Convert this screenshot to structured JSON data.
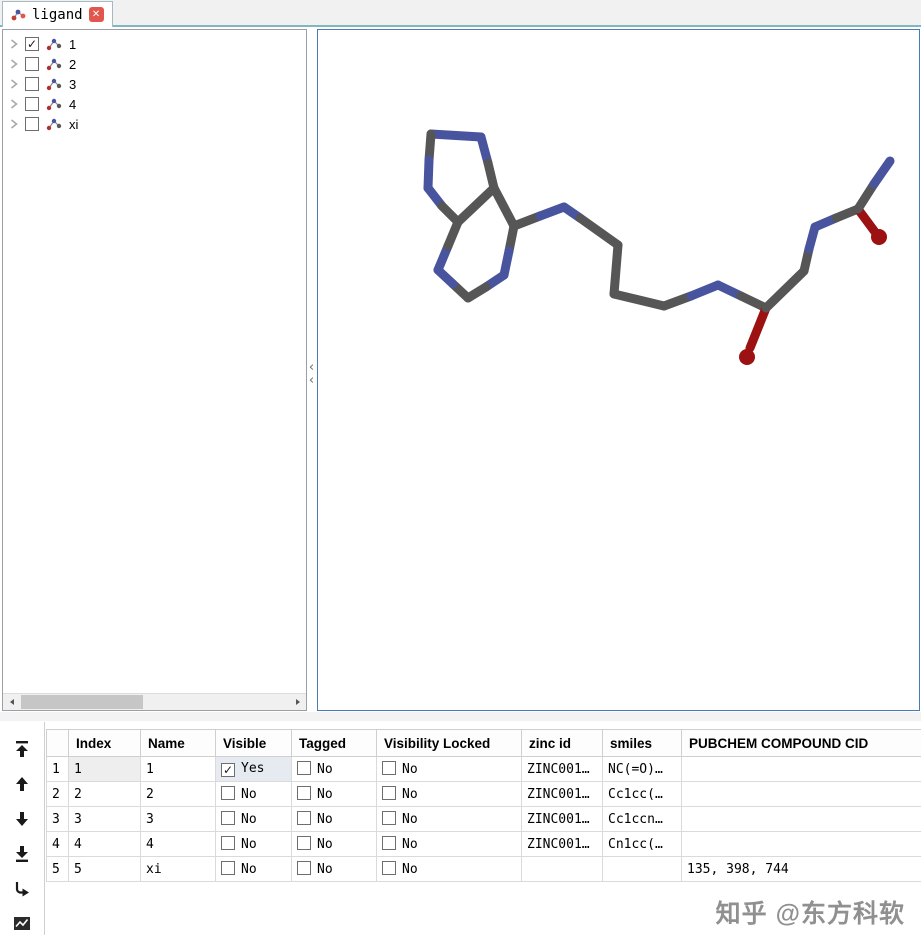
{
  "tab": {
    "title": "ligand",
    "close_glyph": "✕"
  },
  "colors": {
    "viewer_border": "#4a7ab8",
    "tab_underline": "#7fb6c2",
    "close_button": "#e2574d"
  },
  "tree": {
    "items": [
      {
        "label": "1",
        "check_glyph": "✓"
      },
      {
        "label": "2",
        "check_glyph": ""
      },
      {
        "label": "3",
        "check_glyph": ""
      },
      {
        "label": "4",
        "check_glyph": ""
      },
      {
        "label": "xi",
        "check_glyph": ""
      }
    ]
  },
  "viewer": {
    "atom_colors": {
      "carbon": "#565656",
      "nitrogen": "#49549f",
      "oxygen": "#9c1111"
    }
  },
  "toolbar": {
    "buttons": [
      {
        "name": "move-to-top"
      },
      {
        "name": "move-up"
      },
      {
        "name": "move-down"
      },
      {
        "name": "move-to-bottom"
      },
      {
        "name": "export"
      },
      {
        "name": "plot"
      }
    ]
  },
  "splitter": {
    "collapse_glyph_top": "‹",
    "collapse_glyph_bottom": "‹"
  },
  "table": {
    "headers": [
      "Index",
      "Name",
      "Visible",
      "Tagged",
      "Visibility Locked",
      "zinc id",
      "smiles",
      "PUBCHEM COMPOUND CID"
    ],
    "rows": [
      {
        "num": "1",
        "index": "1",
        "name": "1",
        "visible": {
          "glyph": "✓",
          "label": "Yes"
        },
        "tagged": {
          "glyph": "",
          "label": "No"
        },
        "locked": {
          "glyph": "",
          "label": "No"
        },
        "zinc_id": "ZINC001…",
        "smiles": "NC(=O)…",
        "cid": ""
      },
      {
        "num": "2",
        "index": "2",
        "name": "2",
        "visible": {
          "glyph": "",
          "label": "No"
        },
        "tagged": {
          "glyph": "",
          "label": "No"
        },
        "locked": {
          "glyph": "",
          "label": "No"
        },
        "zinc_id": "ZINC001…",
        "smiles": "Cc1cc(…",
        "cid": ""
      },
      {
        "num": "3",
        "index": "3",
        "name": "3",
        "visible": {
          "glyph": "",
          "label": "No"
        },
        "tagged": {
          "glyph": "",
          "label": "No"
        },
        "locked": {
          "glyph": "",
          "label": "No"
        },
        "zinc_id": "ZINC001…",
        "smiles": "Cc1ccn…",
        "cid": ""
      },
      {
        "num": "4",
        "index": "4",
        "name": "4",
        "visible": {
          "glyph": "",
          "label": "No"
        },
        "tagged": {
          "glyph": "",
          "label": "No"
        },
        "locked": {
          "glyph": "",
          "label": "No"
        },
        "zinc_id": "ZINC001…",
        "smiles": "Cn1cc(…",
        "cid": ""
      },
      {
        "num": "5",
        "index": "5",
        "name": "xi",
        "visible": {
          "glyph": "",
          "label": "No"
        },
        "tagged": {
          "glyph": "",
          "label": "No"
        },
        "locked": {
          "glyph": "",
          "label": "No"
        },
        "zinc_id": "",
        "smiles": "",
        "cid": "135, 398, 744"
      }
    ]
  },
  "watermark": "知乎 @东方科软"
}
